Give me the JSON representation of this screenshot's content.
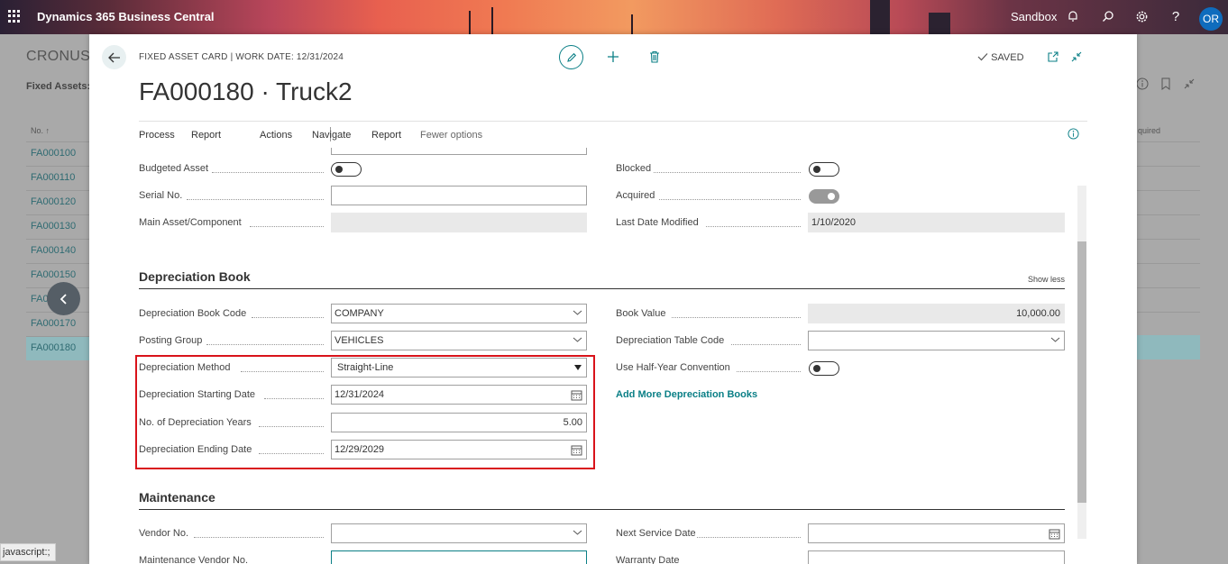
{
  "topbar": {
    "app_name": "Dynamics 365 Business Central",
    "environment": "Sandbox",
    "avatar_initials": "OR"
  },
  "background_page": {
    "title": "CRONUS U",
    "subtitle": "Fixed Assets:",
    "column_no": "No. ↑",
    "column_acquired": "quired",
    "rows": [
      "FA000100",
      "FA000110",
      "FA000120",
      "FA000130",
      "FA000140",
      "FA000150",
      "FA0",
      "FA000170",
      "FA000180"
    ],
    "selected_row": "FA000180"
  },
  "dialog": {
    "caption": "FIXED ASSET CARD | WORK DATE: 12/31/2024",
    "status": "SAVED",
    "title": "FA000180 · Truck2",
    "actions": [
      "Process",
      "Report",
      "Actions",
      "Navigate",
      "Report",
      "Fewer options"
    ]
  },
  "general": {
    "budgeted_asset_label": "Budgeted Asset",
    "budgeted_asset_value": false,
    "serial_no_label": "Serial No.",
    "serial_no_value": "",
    "main_asset_label": "Main Asset/Component",
    "main_asset_value": "",
    "blocked_label": "Blocked",
    "blocked_value": false,
    "acquired_label": "Acquired",
    "acquired_value": true,
    "last_modified_label": "Last Date Modified",
    "last_modified_value": "1/10/2020"
  },
  "depreciation": {
    "section_title": "Depreciation Book",
    "show_less": "Show less",
    "book_code_label": "Depreciation Book Code",
    "book_code_value": "COMPANY",
    "posting_group_label": "Posting Group",
    "posting_group_value": "VEHICLES",
    "method_label": "Depreciation Method",
    "method_value": "Straight-Line",
    "start_date_label": "Depreciation Starting Date",
    "start_date_value": "12/31/2024",
    "years_label": "No. of Depreciation Years",
    "years_value": "5.00",
    "end_date_label": "Depreciation Ending Date",
    "end_date_value": "12/29/2029",
    "book_value_label": "Book Value",
    "book_value_value": "10,000.00",
    "table_code_label": "Depreciation Table Code",
    "table_code_value": "",
    "half_year_label": "Use Half-Year Convention",
    "half_year_value": false,
    "add_books_link": "Add More Depreciation Books"
  },
  "maintenance": {
    "section_title": "Maintenance",
    "vendor_no_label": "Vendor No.",
    "maint_vendor_label": "Maintenance Vendor No.",
    "next_service_label": "Next Service Date",
    "warranty_label": "Warranty Date"
  },
  "statusbar": {
    "text": "javascript:;"
  },
  "colors": {
    "accent": "#0a7f86",
    "highlight": "#d9131a",
    "avatar": "#0f6cbd"
  }
}
